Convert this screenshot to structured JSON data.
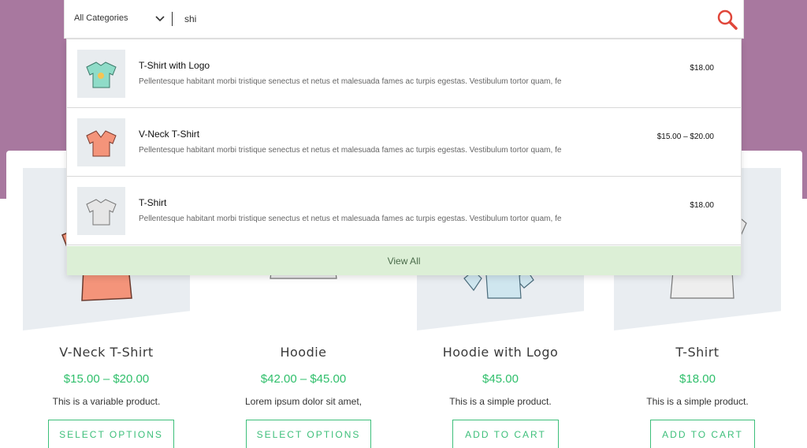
{
  "search": {
    "category": "All Categories",
    "query": "shi",
    "results": [
      {
        "title": "T-Shirt with Logo",
        "description": "Pellentesque habitant morbi tristique senectus et netus et malesuada fames ac turpis egestas. Vestibulum tortor quam, fe",
        "price": "$18.00",
        "thumb_color": "#8fdcc8"
      },
      {
        "title": "V-Neck T-Shirt",
        "description": "Pellentesque habitant morbi tristique senectus et netus et malesuada fames ac turpis egestas. Vestibulum tortor quam, fe",
        "price": "$15.00 – $20.00",
        "thumb_color": "#f4947a"
      },
      {
        "title": "T-Shirt",
        "description": "Pellentesque habitant morbi tristique senectus et netus et malesuada fames ac turpis egestas. Vestibulum tortor quam, fe",
        "price": "$18.00",
        "thumb_color": "#e6e6e6"
      }
    ],
    "view_all_label": "View All"
  },
  "products": [
    {
      "name": "V-Neck T-Shirt",
      "price": "$15.00 – $20.00",
      "description": "This is a variable product.",
      "button": "SELECT OPTIONS",
      "image_color": "#f4947a"
    },
    {
      "name": "Hoodie",
      "price": "$42.00 – $45.00",
      "description": "Lorem ipsum dolor sit amet,",
      "button": "SELECT OPTIONS",
      "image_color": "#e6e6e6"
    },
    {
      "name": "Hoodie with Logo",
      "price": "$45.00",
      "description": "This is a simple product.",
      "button": "ADD TO CART",
      "image_color": "#cfe6ef"
    },
    {
      "name": "T-Shirt",
      "price": "$18.00",
      "description": "This is a simple product.",
      "button": "ADD TO CART",
      "image_color": "#e6e6e6"
    }
  ],
  "colors": {
    "hero": "#a8789f",
    "accent_green": "#3dbf7a",
    "price_green": "#2fbf6b",
    "view_all_bg": "#dcefd6",
    "search_icon": "#e0463a"
  }
}
